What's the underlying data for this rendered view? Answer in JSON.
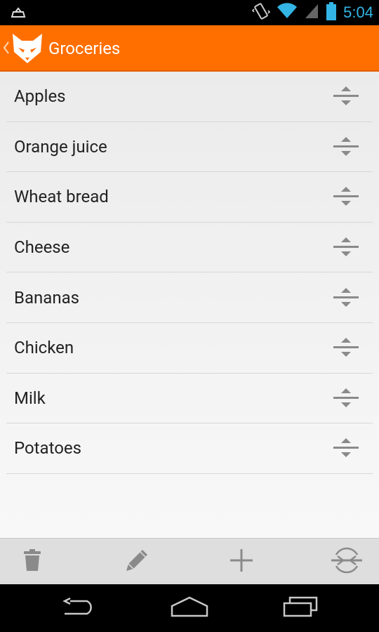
{
  "status_bar": {
    "time": "5:04",
    "icons": [
      "notification-icon",
      "vibrate-icon",
      "wifi-icon",
      "signal-icon",
      "battery-icon"
    ]
  },
  "action_bar": {
    "title": "Groceries",
    "up_icon": "chevron-left-icon",
    "logo": "fox-logo"
  },
  "list": {
    "items": [
      {
        "label": "Apples"
      },
      {
        "label": "Orange juice"
      },
      {
        "label": "Wheat bread"
      },
      {
        "label": "Cheese"
      },
      {
        "label": "Bananas"
      },
      {
        "label": "Chicken"
      },
      {
        "label": "Milk"
      },
      {
        "label": "Potatoes"
      }
    ]
  },
  "bottom_bar": {
    "buttons": [
      "trash-icon",
      "pencil-icon",
      "plus-icon",
      "merge-icon"
    ]
  },
  "nav_bar": {
    "buttons": [
      "back-icon",
      "home-icon",
      "recents-icon"
    ]
  },
  "colors": {
    "accent": "#ff6f00",
    "status_text": "#33b5e5",
    "icon_gray": "#8a8a8a"
  }
}
